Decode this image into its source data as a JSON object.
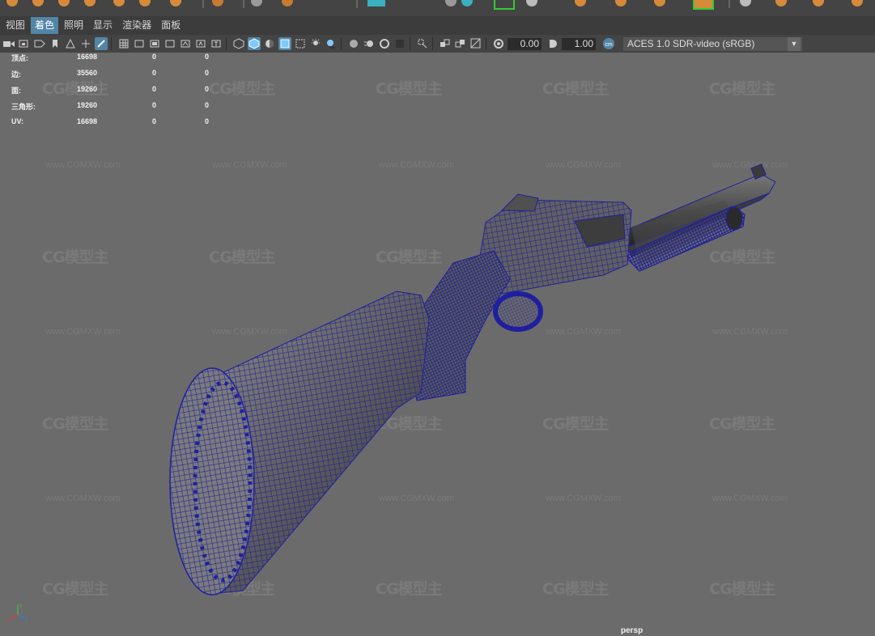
{
  "menu": {
    "items": [
      "视图",
      "着色",
      "照明",
      "显示",
      "渲染器",
      "面板"
    ],
    "active_index": 1
  },
  "toolbar": {
    "exposure_value": "0.00",
    "gamma_value": "1.00",
    "color_space": "ACES 1.0 SDR-video (sRGB)"
  },
  "hud": {
    "rows": [
      {
        "label": "顶点:",
        "v1": "16698",
        "v2": "0",
        "v3": "0"
      },
      {
        "label": "边:",
        "v1": "35560",
        "v2": "0",
        "v3": "0"
      },
      {
        "label": "面:",
        "v1": "19260",
        "v2": "0",
        "v3": "0"
      },
      {
        "label": "三角形:",
        "v1": "19260",
        "v2": "0",
        "v3": "0"
      },
      {
        "label": "UV:",
        "v1": "16698",
        "v2": "0",
        "v3": "0"
      }
    ]
  },
  "watermark": {
    "logo_text": "CG模型主",
    "url_text": "www.CGMXW.com"
  },
  "viewport": {
    "camera_label": "persp",
    "axis_labels": {
      "x": "x",
      "y": "y",
      "z": "z"
    },
    "wire_color": "#1f1fa0",
    "background_color": "#6b6b6b"
  }
}
